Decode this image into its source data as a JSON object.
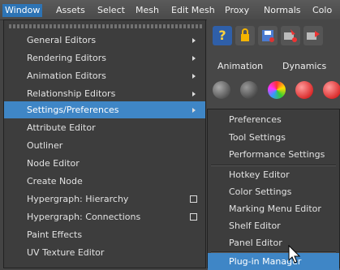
{
  "menubar": {
    "items": [
      "Window",
      "Assets",
      "Select",
      "Mesh",
      "Edit Mesh",
      "Proxy",
      "Normals",
      "Colo"
    ]
  },
  "window_menu": {
    "items": [
      {
        "label": "General Editors",
        "submenu": true
      },
      {
        "label": "Rendering Editors",
        "submenu": true
      },
      {
        "label": "Animation Editors",
        "submenu": true
      },
      {
        "label": "Relationship Editors",
        "submenu": true
      },
      {
        "label": "Settings/Preferences",
        "submenu": true,
        "highlighted": true
      },
      {
        "label": "Attribute Editor"
      },
      {
        "label": "Outliner"
      },
      {
        "label": "Node Editor"
      },
      {
        "label": "Create Node"
      },
      {
        "label": "Hypergraph: Hierarchy",
        "option_box": true
      },
      {
        "label": "Hypergraph: Connections",
        "option_box": true
      },
      {
        "label": "Paint Effects"
      },
      {
        "label": "UV Texture Editor"
      }
    ]
  },
  "settings_submenu": {
    "items": [
      "Preferences",
      "Tool Settings",
      "Performance Settings",
      "Hotkey Editor",
      "Color Settings",
      "Marking Menu Editor",
      "Shelf Editor",
      "Panel Editor",
      "Plug-in Manager"
    ],
    "highlighted": "Plug-in Manager"
  },
  "shelf_tabs": [
    "Animation",
    "Dynamics"
  ],
  "colors": {
    "highlight": "#3f86c6",
    "menu_bg": "#3d3d3d",
    "menubar_active": "#2d74b5"
  },
  "icons": [
    "help-icon",
    "lock-icon",
    "save-icon",
    "render-icon",
    "render-region-icon"
  ]
}
